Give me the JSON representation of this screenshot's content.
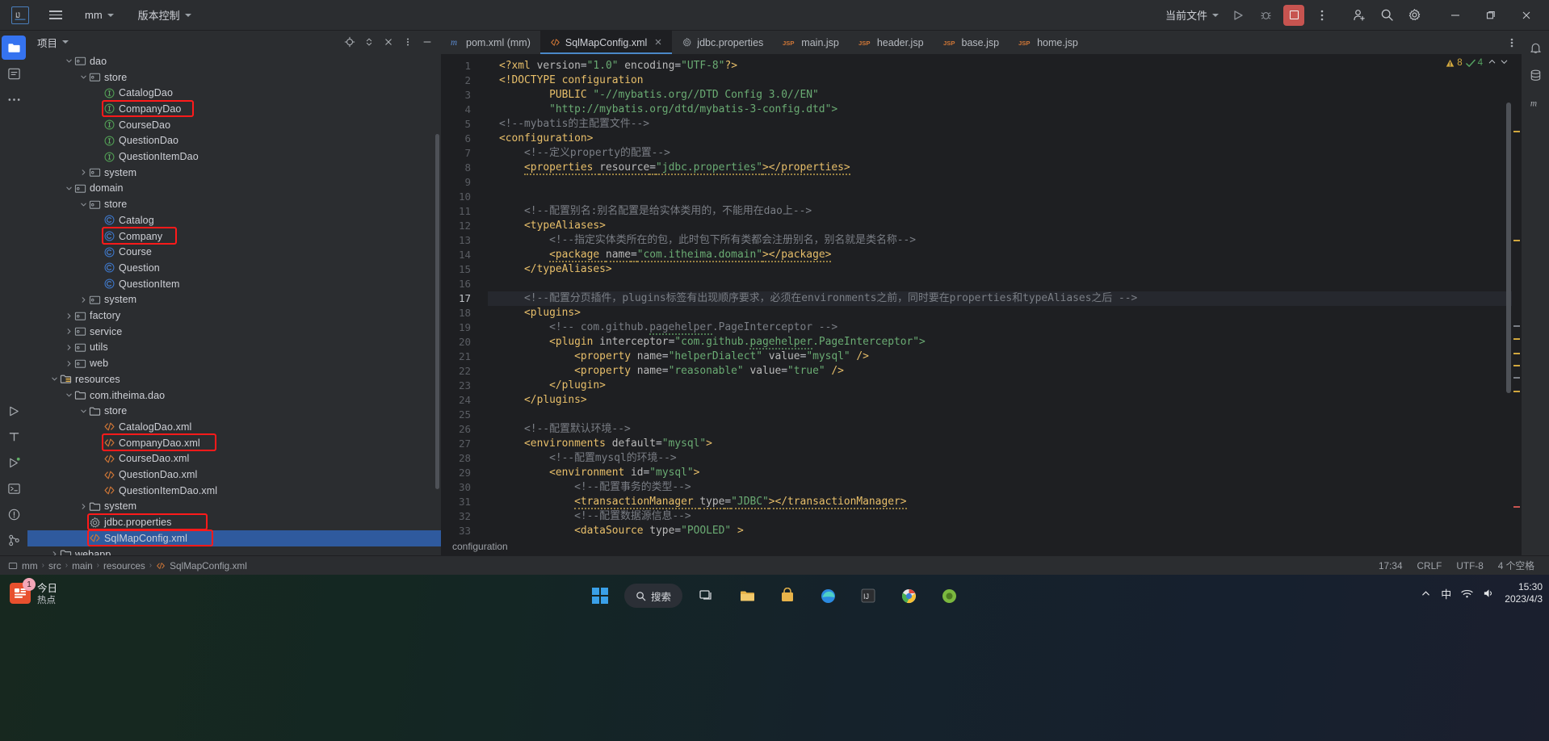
{
  "titlebar": {
    "logo": "IJ",
    "project_name": "mm",
    "vcs_label": "版本控制",
    "run_config": "当前文件",
    "icons": {
      "hamburger": "hamburger-icon",
      "run": "run-icon",
      "debug": "debug-icon",
      "stop": "stop-icon",
      "more": "more-vertical-icon",
      "share": "add-user-icon",
      "search": "search-icon",
      "settings": "gear-icon",
      "minimize": "minimize-icon",
      "maximize": "maximize-icon",
      "close": "close-icon"
    }
  },
  "project_panel": {
    "title": "项目",
    "tools": [
      "locate-icon",
      "expand-collapse-icon",
      "close-icon",
      "more-icon",
      "hide-icon"
    ],
    "tree": [
      {
        "label": "dao",
        "indent": 2,
        "type": "package",
        "arrow": "open"
      },
      {
        "label": "store",
        "indent": 3,
        "type": "package",
        "arrow": "open"
      },
      {
        "label": "CatalogDao",
        "indent": 4,
        "type": "interface",
        "arrow": "none"
      },
      {
        "label": "CompanyDao",
        "indent": 4,
        "type": "interface",
        "arrow": "none",
        "highlight": true
      },
      {
        "label": "CourseDao",
        "indent": 4,
        "type": "interface",
        "arrow": "none"
      },
      {
        "label": "QuestionDao",
        "indent": 4,
        "type": "interface",
        "arrow": "none"
      },
      {
        "label": "QuestionItemDao",
        "indent": 4,
        "type": "interface",
        "arrow": "none"
      },
      {
        "label": "system",
        "indent": 3,
        "type": "package",
        "arrow": "closed"
      },
      {
        "label": "domain",
        "indent": 2,
        "type": "package",
        "arrow": "open"
      },
      {
        "label": "store",
        "indent": 3,
        "type": "package",
        "arrow": "open"
      },
      {
        "label": "Catalog",
        "indent": 4,
        "type": "class",
        "arrow": "none"
      },
      {
        "label": "Company",
        "indent": 4,
        "type": "class",
        "arrow": "none",
        "highlight": true
      },
      {
        "label": "Course",
        "indent": 4,
        "type": "class",
        "arrow": "none"
      },
      {
        "label": "Question",
        "indent": 4,
        "type": "class",
        "arrow": "none"
      },
      {
        "label": "QuestionItem",
        "indent": 4,
        "type": "class",
        "arrow": "none"
      },
      {
        "label": "system",
        "indent": 3,
        "type": "package",
        "arrow": "closed"
      },
      {
        "label": "factory",
        "indent": 2,
        "type": "package",
        "arrow": "closed"
      },
      {
        "label": "service",
        "indent": 2,
        "type": "package",
        "arrow": "closed"
      },
      {
        "label": "utils",
        "indent": 2,
        "type": "package",
        "arrow": "closed"
      },
      {
        "label": "web",
        "indent": 2,
        "type": "package",
        "arrow": "closed"
      },
      {
        "label": "resources",
        "indent": 1,
        "type": "resources",
        "arrow": "open"
      },
      {
        "label": "com.itheima.dao",
        "indent": 2,
        "type": "folder",
        "arrow": "open"
      },
      {
        "label": "store",
        "indent": 3,
        "type": "folder",
        "arrow": "open"
      },
      {
        "label": "CatalogDao.xml",
        "indent": 4,
        "type": "xml",
        "arrow": "none"
      },
      {
        "label": "CompanyDao.xml",
        "indent": 4,
        "type": "xml",
        "arrow": "none",
        "highlight": true
      },
      {
        "label": "CourseDao.xml",
        "indent": 4,
        "type": "xml",
        "arrow": "none"
      },
      {
        "label": "QuestionDao.xml",
        "indent": 4,
        "type": "xml",
        "arrow": "none"
      },
      {
        "label": "QuestionItemDao.xml",
        "indent": 4,
        "type": "xml",
        "arrow": "none"
      },
      {
        "label": "system",
        "indent": 3,
        "type": "folder",
        "arrow": "closed"
      },
      {
        "label": "jdbc.properties",
        "indent": 3,
        "type": "properties",
        "arrow": "none",
        "highlight": true
      },
      {
        "label": "SqlMapConfig.xml",
        "indent": 3,
        "type": "xml",
        "arrow": "none",
        "selected": true,
        "highlight": true
      },
      {
        "label": "webapp",
        "indent": 1,
        "type": "folder",
        "arrow": "closed"
      }
    ]
  },
  "editor": {
    "tabs": [
      {
        "label": "pom.xml (mm)",
        "icon": "maven-icon",
        "active": false,
        "closable": false
      },
      {
        "label": "SqlMapConfig.xml",
        "icon": "xml-icon",
        "active": true,
        "closable": true
      },
      {
        "label": "jdbc.properties",
        "icon": "properties-icon",
        "active": false,
        "closable": false
      },
      {
        "label": "main.jsp",
        "icon": "jsp-icon",
        "active": false,
        "closable": false
      },
      {
        "label": "header.jsp",
        "icon": "jsp-icon",
        "active": false,
        "closable": false
      },
      {
        "label": "base.jsp",
        "icon": "jsp-icon",
        "active": false,
        "closable": false
      },
      {
        "label": "home.jsp",
        "icon": "jsp-icon",
        "active": false,
        "closable": false
      }
    ],
    "inspection": {
      "warnings": "8",
      "checks": "4"
    },
    "current_line": 17,
    "breadcrumb": "configuration",
    "lines": [
      {
        "n": 1,
        "segs": [
          {
            "t": "<?xml ",
            "c": "tag"
          },
          {
            "t": "version",
            "c": "attr"
          },
          {
            "t": "=",
            "c": "plain"
          },
          {
            "t": "\"1.0\"",
            "c": "str"
          },
          {
            "t": " encoding",
            "c": "attr"
          },
          {
            "t": "=",
            "c": "plain"
          },
          {
            "t": "\"UTF-8\"",
            "c": "str"
          },
          {
            "t": "?>",
            "c": "tag"
          }
        ]
      },
      {
        "n": 2,
        "segs": [
          {
            "t": "<!DOCTYPE configuration",
            "c": "doctype"
          }
        ]
      },
      {
        "n": 3,
        "segs": [
          {
            "t": "        PUBLIC ",
            "c": "doctype"
          },
          {
            "t": "\"-//mybatis.org//DTD Config 3.0//EN\"",
            "c": "str"
          }
        ]
      },
      {
        "n": 4,
        "segs": [
          {
            "t": "        ",
            "c": "plain"
          },
          {
            "t": "\"http://mybatis.org/dtd/mybatis-3-config.dtd\">",
            "c": "str"
          }
        ]
      },
      {
        "n": 5,
        "segs": [
          {
            "t": "<!--mybatis的主配置文件-->",
            "c": "cmt"
          }
        ]
      },
      {
        "n": 6,
        "segs": [
          {
            "t": "<configuration>",
            "c": "tag"
          }
        ]
      },
      {
        "n": 7,
        "segs": [
          {
            "t": "    <!--定义property的配置-->",
            "c": "cmt"
          }
        ]
      },
      {
        "n": 8,
        "segs": [
          {
            "t": "    ",
            "c": "plain"
          },
          {
            "t": "<properties ",
            "c": "tag",
            "u": "w"
          },
          {
            "t": "resource",
            "c": "attr",
            "u": "w"
          },
          {
            "t": "=",
            "c": "plain",
            "u": "w"
          },
          {
            "t": "\"jdbc.properties\"",
            "c": "str",
            "u": "w"
          },
          {
            "t": "></properties>",
            "c": "tag",
            "u": "w"
          }
        ]
      },
      {
        "n": 9,
        "segs": []
      },
      {
        "n": 10,
        "segs": []
      },
      {
        "n": 11,
        "segs": [
          {
            "t": "    <!--配置别名:别名配置是给实体类用的，不能用在dao上-->",
            "c": "cmt"
          }
        ]
      },
      {
        "n": 12,
        "segs": [
          {
            "t": "    <typeAliases>",
            "c": "tag"
          }
        ]
      },
      {
        "n": 13,
        "segs": [
          {
            "t": "        <!--指定实体类所在的包，此时包下所有类都会注册别名，别名就是类名称-->",
            "c": "cmt"
          }
        ]
      },
      {
        "n": 14,
        "segs": [
          {
            "t": "        ",
            "c": "plain"
          },
          {
            "t": "<package ",
            "c": "tag",
            "u": "w"
          },
          {
            "t": "name",
            "c": "attr",
            "u": "w"
          },
          {
            "t": "=",
            "c": "plain",
            "u": "w"
          },
          {
            "t": "\"com.itheima.domain\"",
            "c": "str",
            "u": "w"
          },
          {
            "t": "></package>",
            "c": "tag",
            "u": "w"
          }
        ]
      },
      {
        "n": 15,
        "segs": [
          {
            "t": "    </typeAliases>",
            "c": "tag"
          }
        ]
      },
      {
        "n": 16,
        "segs": []
      },
      {
        "n": 17,
        "segs": [
          {
            "t": "    <!--配置分页插件，plugins标签有出现顺序要求，必须在environments之前，同时要在properties和typeAliases之后 -->",
            "c": "cmt"
          }
        ],
        "cur": true
      },
      {
        "n": 18,
        "segs": [
          {
            "t": "    <plugins>",
            "c": "tag"
          }
        ]
      },
      {
        "n": 19,
        "segs": [
          {
            "t": "        <!-- com.github.",
            "c": "cmt"
          },
          {
            "t": "pagehelper",
            "c": "cmt",
            "u": "g"
          },
          {
            "t": ".PageInterceptor -->",
            "c": "cmt"
          }
        ]
      },
      {
        "n": 20,
        "segs": [
          {
            "t": "        ",
            "c": "plain"
          },
          {
            "t": "<plugin ",
            "c": "tag"
          },
          {
            "t": "interceptor",
            "c": "attr"
          },
          {
            "t": "=",
            "c": "plain"
          },
          {
            "t": "\"com.github.",
            "c": "str"
          },
          {
            "t": "pagehelper",
            "c": "str",
            "u": "g"
          },
          {
            "t": ".PageInterceptor\">",
            "c": "str"
          }
        ]
      },
      {
        "n": 21,
        "segs": [
          {
            "t": "            ",
            "c": "plain"
          },
          {
            "t": "<property ",
            "c": "tag"
          },
          {
            "t": "name",
            "c": "attr"
          },
          {
            "t": "=",
            "c": "plain"
          },
          {
            "t": "\"helperDialect\"",
            "c": "str"
          },
          {
            "t": " value",
            "c": "attr"
          },
          {
            "t": "=",
            "c": "plain"
          },
          {
            "t": "\"mysql\"",
            "c": "str"
          },
          {
            "t": " />",
            "c": "tag"
          }
        ]
      },
      {
        "n": 22,
        "segs": [
          {
            "t": "            ",
            "c": "plain"
          },
          {
            "t": "<property ",
            "c": "tag"
          },
          {
            "t": "name",
            "c": "attr"
          },
          {
            "t": "=",
            "c": "plain"
          },
          {
            "t": "\"reasonable\"",
            "c": "str"
          },
          {
            "t": " value",
            "c": "attr"
          },
          {
            "t": "=",
            "c": "plain"
          },
          {
            "t": "\"true\"",
            "c": "str"
          },
          {
            "t": " />",
            "c": "tag"
          }
        ]
      },
      {
        "n": 23,
        "segs": [
          {
            "t": "        </plugin>",
            "c": "tag"
          }
        ]
      },
      {
        "n": 24,
        "segs": [
          {
            "t": "    </plugins>",
            "c": "tag"
          }
        ]
      },
      {
        "n": 25,
        "segs": []
      },
      {
        "n": 26,
        "segs": [
          {
            "t": "    <!--配置默认环境-->",
            "c": "cmt"
          }
        ]
      },
      {
        "n": 27,
        "segs": [
          {
            "t": "    ",
            "c": "plain"
          },
          {
            "t": "<environments ",
            "c": "tag"
          },
          {
            "t": "default",
            "c": "attr"
          },
          {
            "t": "=",
            "c": "plain"
          },
          {
            "t": "\"mysql\"",
            "c": "str"
          },
          {
            "t": ">",
            "c": "tag"
          }
        ]
      },
      {
        "n": 28,
        "segs": [
          {
            "t": "        <!--配置mysql的环境-->",
            "c": "cmt"
          }
        ]
      },
      {
        "n": 29,
        "segs": [
          {
            "t": "        ",
            "c": "plain"
          },
          {
            "t": "<environment ",
            "c": "tag"
          },
          {
            "t": "id",
            "c": "attr"
          },
          {
            "t": "=",
            "c": "plain"
          },
          {
            "t": "\"mysql\"",
            "c": "str"
          },
          {
            "t": ">",
            "c": "tag"
          }
        ]
      },
      {
        "n": 30,
        "segs": [
          {
            "t": "            <!--配置事务的类型-->",
            "c": "cmt"
          }
        ]
      },
      {
        "n": 31,
        "segs": [
          {
            "t": "            ",
            "c": "plain"
          },
          {
            "t": "<transactionManager ",
            "c": "tag",
            "u": "w"
          },
          {
            "t": "type",
            "c": "attr",
            "u": "w"
          },
          {
            "t": "=",
            "c": "plain",
            "u": "w"
          },
          {
            "t": "\"JDBC\"",
            "c": "str",
            "u": "w"
          },
          {
            "t": "></transactionManager>",
            "c": "tag",
            "u": "w"
          }
        ]
      },
      {
        "n": 32,
        "segs": [
          {
            "t": "            <!--配置数据源信息-->",
            "c": "cmt"
          }
        ]
      },
      {
        "n": 33,
        "segs": [
          {
            "t": "            ",
            "c": "plain"
          },
          {
            "t": "<dataSource ",
            "c": "tag"
          },
          {
            "t": "type",
            "c": "attr"
          },
          {
            "t": "=",
            "c": "plain"
          },
          {
            "t": "\"POOLED\"",
            "c": "str"
          },
          {
            "t": " >",
            "c": "tag"
          }
        ]
      }
    ]
  },
  "statusbar": {
    "crumbs": [
      "mm",
      "src",
      "main",
      "resources",
      "SqlMapConfig.xml"
    ],
    "right": [
      "17:34",
      "CRLF",
      "UTF-8",
      "4 个空格"
    ]
  },
  "taskbar": {
    "news": {
      "title": "今日",
      "subtitle": "热点",
      "badge": "1"
    },
    "search_label": "搜索",
    "apps": [
      "start-icon",
      "search-pill",
      "task-view-icon",
      "file-explorer-icon",
      "store-icon",
      "edge-icon",
      "ide-icon",
      "chrome-icon",
      "game-icon"
    ],
    "clock": {
      "time": "15:30",
      "date": "2023/4/3"
    },
    "tray": [
      "chevron-up-icon",
      "ime-icon",
      "network-icon",
      "volume-icon"
    ]
  }
}
